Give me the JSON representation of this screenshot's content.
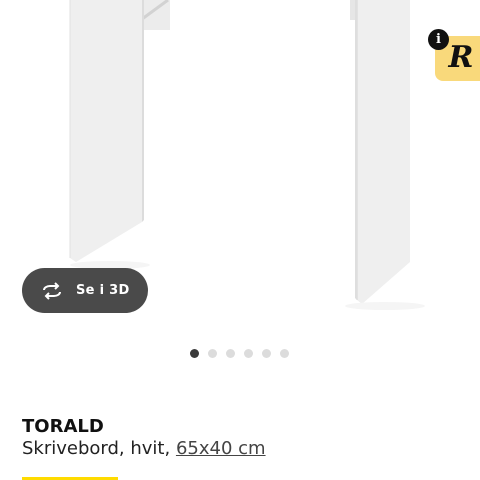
{
  "product": {
    "name": "TORALD",
    "description": "Skrivebord, hvit, ",
    "size_link": "65x40 cm"
  },
  "view_3d": {
    "label": "Se i 3D",
    "icon": "rotate-arrows-icon"
  },
  "badge": {
    "logo_text": "R",
    "info_text": "i",
    "color": "#f9d97b"
  },
  "carousel": {
    "total_images": 6,
    "active_index": 0
  },
  "colors": {
    "accent": "#ffdb00",
    "button_bg": "#4a4a4a",
    "dot_active": "#3a3a3a",
    "dot_inactive": "#dcdcdc"
  }
}
